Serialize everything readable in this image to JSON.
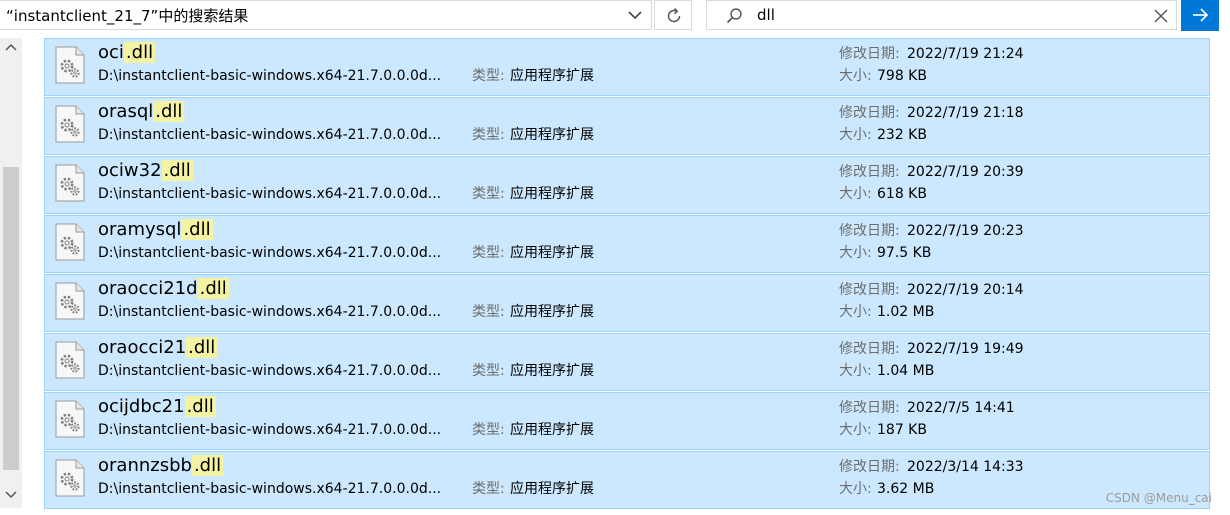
{
  "address_bar": {
    "text": "“instantclient_21_7”中的搜索结果"
  },
  "search": {
    "value": "dll"
  },
  "labels": {
    "type": "类型:",
    "date": "修改日期:",
    "size": "大小:"
  },
  "results": [
    {
      "name_base": "oci",
      "name_ext": ".dll",
      "path": "D:\\instantclient-basic-windows.x64-21.7.0.0.0d...",
      "type": "应用程序扩展",
      "modified": "2022/7/19 21:24",
      "size": "798 KB"
    },
    {
      "name_base": "orasql",
      "name_ext": ".dll",
      "path": "D:\\instantclient-basic-windows.x64-21.7.0.0.0d...",
      "type": "应用程序扩展",
      "modified": "2022/7/19 21:18",
      "size": "232 KB"
    },
    {
      "name_base": "ociw32",
      "name_ext": ".dll",
      "path": "D:\\instantclient-basic-windows.x64-21.7.0.0.0d...",
      "type": "应用程序扩展",
      "modified": "2022/7/19 20:39",
      "size": "618 KB"
    },
    {
      "name_base": "oramysql",
      "name_ext": ".dll",
      "path": "D:\\instantclient-basic-windows.x64-21.7.0.0.0d...",
      "type": "应用程序扩展",
      "modified": "2022/7/19 20:23",
      "size": "97.5 KB"
    },
    {
      "name_base": "oraocci21d",
      "name_ext": ".dll",
      "path": "D:\\instantclient-basic-windows.x64-21.7.0.0.0d...",
      "type": "应用程序扩展",
      "modified": "2022/7/19 20:14",
      "size": "1.02 MB"
    },
    {
      "name_base": "oraocci21",
      "name_ext": ".dll",
      "path": "D:\\instantclient-basic-windows.x64-21.7.0.0.0d...",
      "type": "应用程序扩展",
      "modified": "2022/7/19 19:49",
      "size": "1.04 MB"
    },
    {
      "name_base": "ocijdbc21",
      "name_ext": ".dll",
      "path": "D:\\instantclient-basic-windows.x64-21.7.0.0.0d...",
      "type": "应用程序扩展",
      "modified": "2022/7/5 14:41",
      "size": "187 KB"
    },
    {
      "name_base": "orannzsbb",
      "name_ext": ".dll",
      "path": "D:\\instantclient-basic-windows.x64-21.7.0.0.0d...",
      "type": "应用程序扩展",
      "modified": "2022/3/14 14:33",
      "size": "3.62 MB"
    }
  ],
  "watermark": "CSDN @Menu_cai",
  "icons": {
    "dropdown": "chevron-down-icon",
    "refresh": "refresh-icon",
    "search": "search-icon",
    "clear": "close-icon",
    "go": "arrow-right-icon",
    "file": "dll-file-icon",
    "scroll_up": "scroll-up-icon",
    "scroll_down": "scroll-down-icon"
  },
  "colors": {
    "row_selected": "#cce8ff",
    "row_border": "#99d1ff",
    "highlight": "#f4f3a3",
    "go_button": "#0078d7",
    "label_gray": "#6d6d6d"
  }
}
